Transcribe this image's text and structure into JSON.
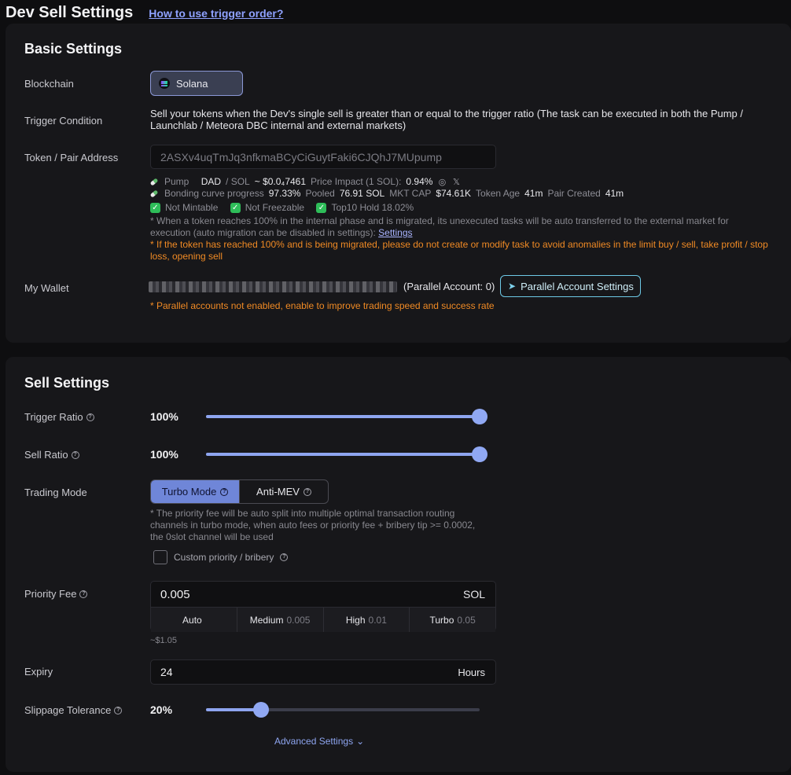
{
  "header": {
    "title": "Dev Sell Settings",
    "help_link": "How to use trigger order?"
  },
  "basic": {
    "title": "Basic Settings",
    "blockchain_label": "Blockchain",
    "blockchain_value": "Solana",
    "trigger_condition_label": "Trigger Condition",
    "trigger_condition_text": "Sell your tokens when the Dev's single sell is greater than or equal to the trigger ratio (The task can be executed in both the Pump / Launchlab / Meteora DBC internal and external markets)",
    "token_label": "Token / Pair Address",
    "token_address": "2ASXv4uqTmJq3nfkmaBCyCiGuytFaki6CJQhJ7MUpump",
    "token_info": {
      "platform": "Pump",
      "pair_base": "DAD",
      "pair_quote": "/ SOL",
      "price": "~ $0.0₄7461",
      "price_impact_label": "Price Impact (1 SOL):",
      "price_impact_value": "0.94%",
      "bonding_label": "Bonding curve progress",
      "bonding_value": "97.33%",
      "pooled_label": "Pooled",
      "pooled_value": "76.91 SOL",
      "mkt_cap_label": "MKT CAP",
      "mkt_cap_value": "$74.61K",
      "token_age_label": "Token Age",
      "token_age_value": "41m",
      "pair_created_label": "Pair Created",
      "pair_created_value": "41m",
      "check_1": "Not Mintable",
      "check_2": "Not Freezable",
      "check_3": "Top10 Hold 18.02%"
    },
    "migration_note": "* When a token reaches 100% in the internal phase and is migrated, its unexecuted tasks will be auto transferred to the external market for execution (auto migration can be disabled in settings): ",
    "migration_settings_link": "Settings",
    "migration_warning": "* If the token has reached 100% and is being migrated, please do not create or modify task to avoid anomalies in the limit buy / sell, take profit / stop loss, opening sell",
    "wallet_label": "My Wallet",
    "parallel_account_text": "(Parallel Account: 0)",
    "parallel_settings_button": "Parallel Account Settings",
    "parallel_warning": "* Parallel accounts not enabled, enable to improve trading speed and success rate"
  },
  "sell": {
    "title": "Sell Settings",
    "trigger_ratio_label": "Trigger Ratio",
    "trigger_ratio_value": "100%",
    "trigger_ratio_fraction": 1.0,
    "sell_ratio_label": "Sell Ratio",
    "sell_ratio_value": "100%",
    "sell_ratio_fraction": 1.0,
    "trading_mode_label": "Trading Mode",
    "mode_turbo": "Turbo Mode",
    "mode_antimev": "Anti-MEV",
    "turbo_note": "* The priority fee will be auto split into multiple optimal transaction routing channels in turbo mode, when auto fees or priority fee + bribery tip >= 0.0002, the 0slot channel will be used",
    "custom_priority_label": "Custom priority / bribery",
    "priority_fee_label": "Priority Fee",
    "priority_fee_value": "0.005",
    "priority_fee_unit": "SOL",
    "fee_options": [
      {
        "label": "Auto",
        "value": ""
      },
      {
        "label": "Medium",
        "value": "0.005"
      },
      {
        "label": "High",
        "value": "0.01"
      },
      {
        "label": "Turbo",
        "value": "0.05"
      }
    ],
    "priority_fee_usd": "~$1.05",
    "expiry_label": "Expiry",
    "expiry_value": "24",
    "expiry_unit": "Hours",
    "slippage_label": "Slippage Tolerance",
    "slippage_value": "20%",
    "slippage_fraction": 0.2,
    "advanced_settings": "Advanced Settings"
  },
  "colors": {
    "accent": "#8ea5f0",
    "warning": "#f08a24",
    "success": "#2ebd59"
  }
}
